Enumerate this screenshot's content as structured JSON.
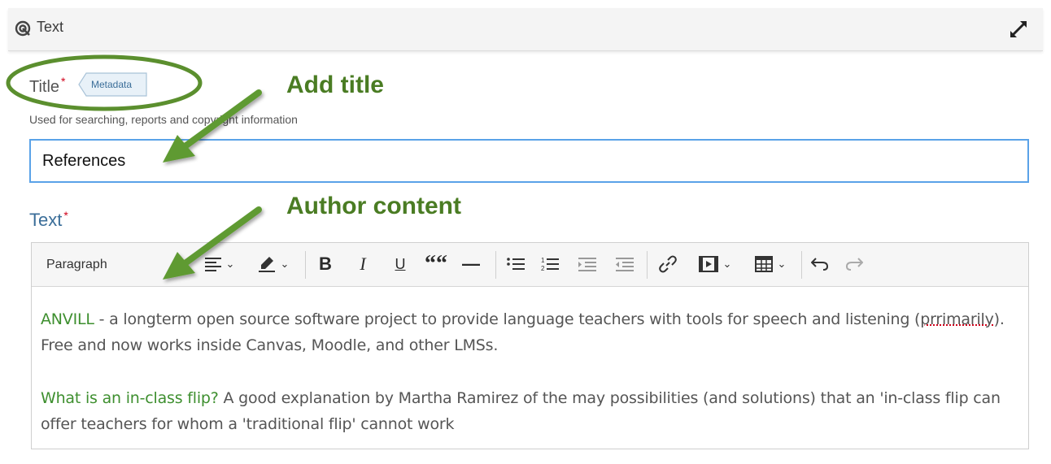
{
  "header": {
    "title": "Text"
  },
  "title_field": {
    "label": "Title",
    "required_mark": "*",
    "metadata_tag": "Metadata",
    "description": "Used for searching, reports and copyright information",
    "value": "References"
  },
  "text_field": {
    "label": "Text",
    "required_mark": "*"
  },
  "annotations": {
    "add_title": "Add title",
    "author_content": "Author content",
    "color": "#4a7c23"
  },
  "toolbar": {
    "paragraph": "Paragraph",
    "bold": "B",
    "italic": "I",
    "underline": "U",
    "quote": "““",
    "hr": "—",
    "icons": [
      "align-icon",
      "highlight-icon",
      "bold-icon",
      "italic-icon",
      "underline-icon",
      "quote-icon",
      "horizontal-rule-icon",
      "bullet-list-icon",
      "numbered-list-icon",
      "indent-icon",
      "outdent-icon",
      "link-icon",
      "media-icon",
      "table-icon",
      "undo-icon",
      "redo-icon"
    ]
  },
  "content": {
    "p1_link": "ANVILL",
    "p1_text_a": " - a longterm open source software project to provide language teachers with tools for speech and listening (",
    "p1_misspelled": "prrimarily",
    "p1_text_b": "). Free and now works inside Canvas, Moodle, and other LMSs.",
    "p2_link": "What is an in-class flip?",
    "p2_text": " A good explanation by Martha Ramirez of the may possibilities (and solutions) that an 'in-class flip can offer teachers for whom a 'traditional flip' cannot work"
  }
}
